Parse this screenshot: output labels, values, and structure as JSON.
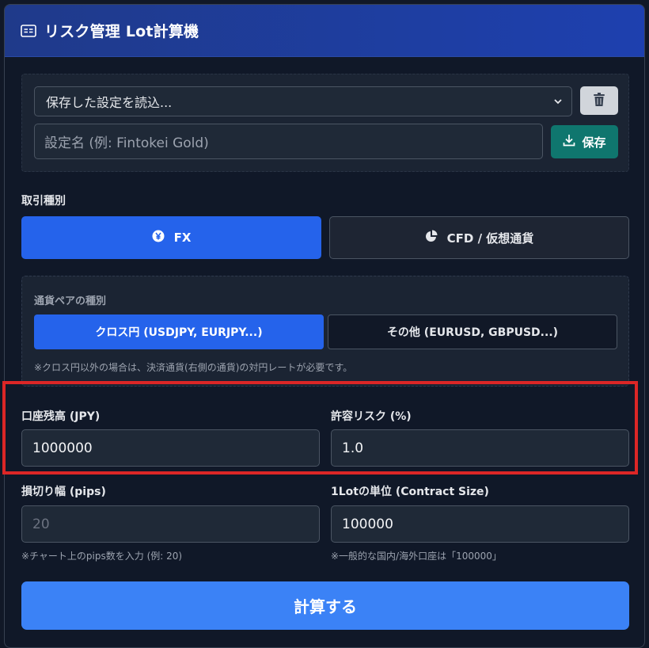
{
  "header": {
    "title": "リスク管理 Lot計算機"
  },
  "presets": {
    "select_value": "保存した設定を読込...",
    "name_placeholder": "設定名 (例: Fintokei Gold)",
    "save_label": "保存"
  },
  "trade_type": {
    "label": "取引種別",
    "options": [
      {
        "label": "FX",
        "selected": true
      },
      {
        "label": "CFD / 仮想通貨",
        "selected": false
      }
    ]
  },
  "pair_type": {
    "label": "通貨ペアの種別",
    "options": [
      {
        "label": "クロス円 (USDJPY, EURJPY...)",
        "selected": true
      },
      {
        "label": "その他 (EURUSD, GBPUSD...)",
        "selected": false
      }
    ],
    "note": "※クロス円以外の場合は、決済通貨(右側の通貨)の対円レートが必要です。"
  },
  "fields": {
    "balance": {
      "label": "口座残高 (JPY)",
      "value": "1000000"
    },
    "risk": {
      "label": "許容リスク (%)",
      "value": "1.0"
    },
    "stop_loss": {
      "label": "損切り幅 (pips)",
      "placeholder": "20",
      "hint": "※チャート上のpips数を入力 (例: 20)"
    },
    "contract_size": {
      "label": "1Lotの単位 (Contract Size)",
      "value": "100000",
      "hint": "※一般的な国内/海外口座は「100000」"
    }
  },
  "calculate_label": "計算する",
  "colors": {
    "primary": "#2563eb",
    "save": "#0f766e",
    "highlight": "#dc2626",
    "calc": "#3b82f6"
  }
}
